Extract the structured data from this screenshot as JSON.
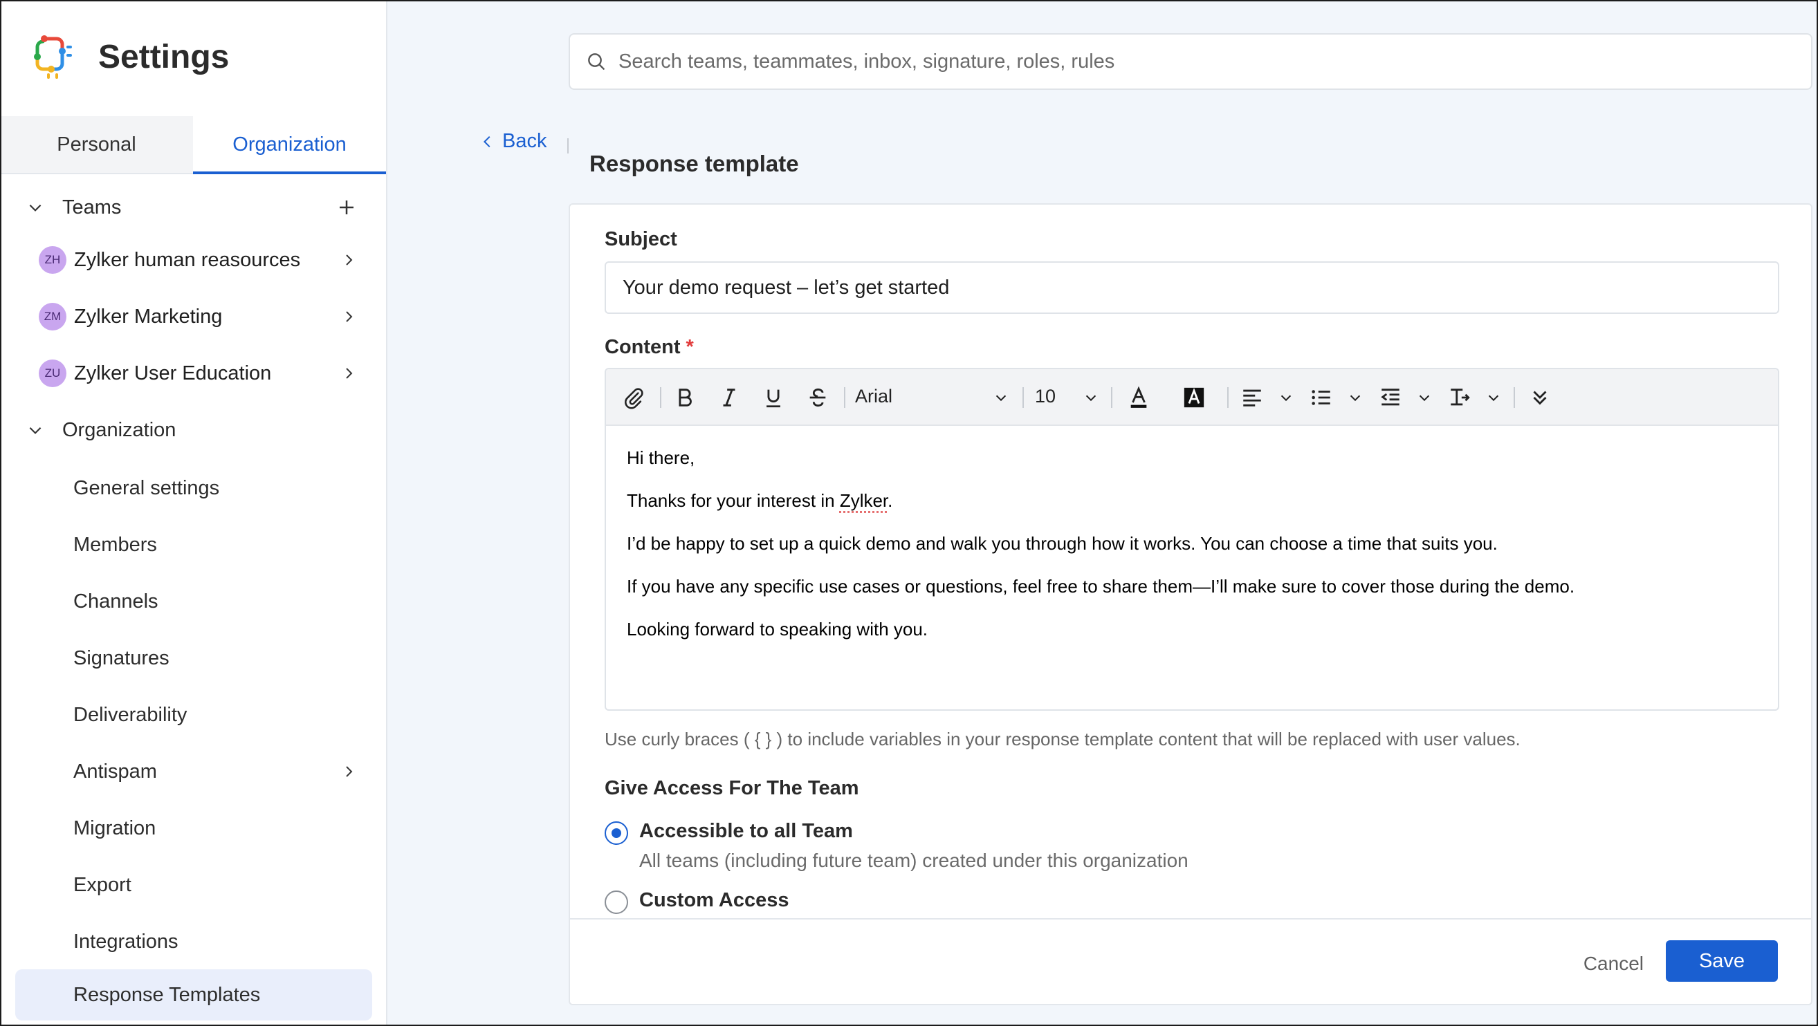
{
  "app": {
    "title": "Settings",
    "icon": "app-logo-icon"
  },
  "sidebar": {
    "tabs": [
      {
        "label": "Personal",
        "active": false
      },
      {
        "label": "Organization",
        "active": true
      }
    ],
    "teams_section": {
      "label": "Teams",
      "items": [
        {
          "initials": "ZH",
          "label": "Zylker human reasources"
        },
        {
          "initials": "ZM",
          "label": "Zylker Marketing"
        },
        {
          "initials": "ZU",
          "label": "Zylker User Education"
        }
      ]
    },
    "org_section": {
      "label": "Organization",
      "items": [
        {
          "label": "General settings"
        },
        {
          "label": "Members"
        },
        {
          "label": "Channels"
        },
        {
          "label": "Signatures"
        },
        {
          "label": "Deliverability"
        },
        {
          "label": "Antispam"
        },
        {
          "label": "Migration"
        },
        {
          "label": "Export"
        },
        {
          "label": "Integrations"
        },
        {
          "label": "Response Templates"
        }
      ]
    }
  },
  "search": {
    "placeholder": "Search teams, teammates, inbox, signature, roles, rules"
  },
  "back_label": "Back",
  "page_title": "Response template",
  "form": {
    "subject_label": "Subject",
    "subject_value": "Your demo request – let’s get started",
    "content_label": "Content",
    "required_mark": "*",
    "toolbar": {
      "font": "Arial",
      "size": "10"
    },
    "content_lines": {
      "l1": "Hi there,",
      "l2a": "Thanks for your interest in ",
      "l2b": "Zylker",
      "l2c": ".",
      "l3": "I’d be happy to set up a quick demo and walk you through how it works. You can choose a time that suits you.",
      "l4": "If you have any specific use cases or questions, feel free to share them—I’ll make sure to cover those during the demo.",
      "l5": "Looking forward to speaking with you."
    },
    "hint": "Use curly braces ( { } ) to include variables in your response template content that will be replaced with user values.",
    "access": {
      "heading": "Give Access For The Team",
      "option_all": {
        "title": "Accessible to all Team",
        "desc": "All teams (including future team) created under this organization"
      },
      "option_custom": {
        "title": "Custom Access"
      }
    }
  },
  "footer": {
    "cancel_label": "Cancel",
    "save_label": "Save"
  },
  "colors": {
    "accent": "#1a5fd1",
    "selected_bg": "#e9eefb",
    "avatar_bg": "#c9a6ef",
    "required": "#e23c3c"
  }
}
